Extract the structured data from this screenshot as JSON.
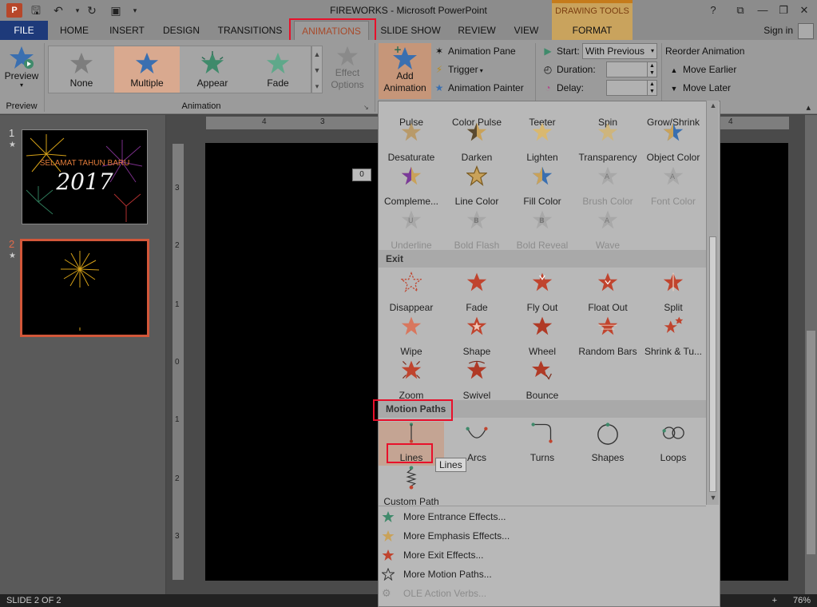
{
  "title_bar": {
    "app_logo": "P",
    "title": "FIREWORKS - Microsoft PowerPoint",
    "contextual_header": "DRAWING TOOLS",
    "help": "?",
    "ribbon_display": "⧉",
    "minimize": "—",
    "restore": "❐",
    "close": "✕"
  },
  "tabs": {
    "file": "FILE",
    "home": "HOME",
    "insert": "INSERT",
    "design": "DESIGN",
    "transitions": "TRANSITIONS",
    "animations": "ANIMATIONS",
    "slide_show": "SLIDE SHOW",
    "review": "REVIEW",
    "view": "VIEW",
    "format": "FORMAT",
    "sign_in": "Sign in"
  },
  "ribbon": {
    "preview": {
      "label": "Preview",
      "group": "Preview"
    },
    "gallery": {
      "group": "Animation",
      "items": [
        {
          "label": "None"
        },
        {
          "label": "Multiple"
        },
        {
          "label": "Appear"
        },
        {
          "label": "Fade"
        }
      ]
    },
    "effect_options": "Effect Options",
    "add_animation": "Add Animation",
    "animation_pane": "Animation Pane",
    "trigger": "Trigger",
    "animation_painter": "Animation Painter",
    "start_label": "Start:",
    "start_value": "With Previous",
    "duration_label": "Duration:",
    "delay_label": "Delay:",
    "reorder_title": "Reorder Animation",
    "move_earlier": "Move Earlier",
    "move_later": "Move Later"
  },
  "slides": {
    "items": [
      {
        "num": "1",
        "text1": "SELAMAT TAHUN BARU",
        "text2": "2017"
      },
      {
        "num": "2"
      }
    ]
  },
  "rulers": {
    "h": [
      "4",
      "3",
      "4"
    ],
    "v": [
      "3",
      "2",
      "1",
      "0",
      "1",
      "2",
      "3"
    ]
  },
  "canvas": {
    "anim_tag": "0"
  },
  "dropdown": {
    "emphasis_top": [
      "Pulse",
      "Color Pulse",
      "Teeter",
      "Spin",
      "Grow/Shrink"
    ],
    "emphasis_row1": [
      "Desaturate",
      "Darken",
      "Lighten",
      "Transparency",
      "Object Color"
    ],
    "emphasis_row2": [
      "Compleme...",
      "Line Color",
      "Fill Color",
      "Brush Color",
      "Font Color"
    ],
    "emphasis_row3": [
      "Underline",
      "Bold Flash",
      "Bold Reveal",
      "Wave"
    ],
    "exit_title": "Exit",
    "exit_row1": [
      "Disappear",
      "Fade",
      "Fly Out",
      "Float Out",
      "Split"
    ],
    "exit_row2": [
      "Wipe",
      "Shape",
      "Wheel",
      "Random Bars",
      "Shrink & Tu..."
    ],
    "exit_row3": [
      "Zoom",
      "Swivel",
      "Bounce"
    ],
    "motion_title": "Motion Paths",
    "motion_row1": [
      "Lines",
      "Arcs",
      "Turns",
      "Shapes",
      "Loops"
    ],
    "motion_row2": [
      "Custom Path"
    ],
    "tooltip": "Lines",
    "links": [
      "More Entrance Effects...",
      "More Emphasis Effects...",
      "More Exit Effects...",
      "More Motion Paths...",
      "OLE Action Verbs..."
    ]
  },
  "status": {
    "slide_info": "SLIDE 2 OF 2",
    "zoom_plus": "+",
    "zoom": "76%"
  },
  "colors": {
    "entrance_star": "#3f8a6b",
    "emphasis_star": "#c9a25a",
    "exit_star": "#c0442e",
    "accent_tab": "#a84a2a",
    "highlight_box": "#e8102a"
  }
}
